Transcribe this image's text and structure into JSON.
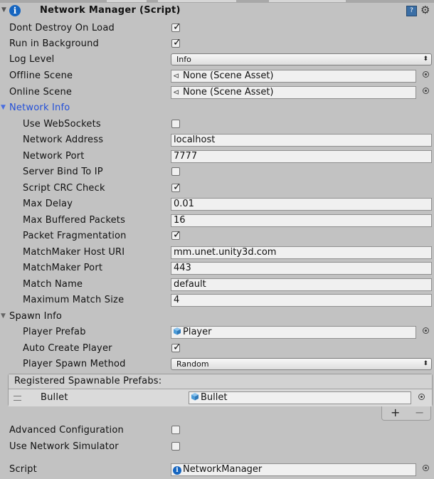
{
  "header": {
    "title": "Network Manager (Script)",
    "info_icon": "i",
    "book_icon": "?",
    "gear_icon": "⚙"
  },
  "rows": {
    "dont_destroy": {
      "label": "Dont Destroy On Load",
      "checked": true
    },
    "run_in_background": {
      "label": "Run in Background",
      "checked": true
    },
    "log_level": {
      "label": "Log Level",
      "value": "Info"
    },
    "offline_scene": {
      "label": "Offline Scene",
      "value": "None (Scene Asset)"
    },
    "online_scene": {
      "label": "Online Scene",
      "value": "None (Scene Asset)"
    }
  },
  "network_info": {
    "label": "Network Info",
    "use_websockets": {
      "label": "Use WebSockets",
      "checked": false
    },
    "network_address": {
      "label": "Network Address",
      "value": "localhost"
    },
    "network_port": {
      "label": "Network Port",
      "value": "7777"
    },
    "server_bind": {
      "label": "Server Bind To IP",
      "checked": false
    },
    "script_crc": {
      "label": "Script CRC Check",
      "checked": true
    },
    "max_delay": {
      "label": "Max Delay",
      "value": "0.01"
    },
    "max_buffered": {
      "label": "Max Buffered Packets",
      "value": "16"
    },
    "packet_frag": {
      "label": "Packet Fragmentation",
      "checked": true
    },
    "mm_host": {
      "label": "MatchMaker Host URI",
      "value": "mm.unet.unity3d.com"
    },
    "mm_port": {
      "label": "MatchMaker Port",
      "value": "443"
    },
    "match_name": {
      "label": "Match Name",
      "value": "default"
    },
    "max_match_size": {
      "label": "Maximum Match Size",
      "value": "4"
    }
  },
  "spawn_info": {
    "label": "Spawn Info",
    "player_prefab": {
      "label": "Player Prefab",
      "value": "Player"
    },
    "auto_create": {
      "label": "Auto Create Player",
      "checked": true
    },
    "spawn_method": {
      "label": "Player Spawn Method",
      "value": "Random"
    },
    "registered": {
      "header": "Registered Spawnable Prefabs:",
      "items": [
        {
          "label": "Bullet",
          "value": "Bullet"
        }
      ],
      "add": "+",
      "remove": "−"
    }
  },
  "advanced": {
    "label": "Advanced Configuration",
    "checked": false
  },
  "simulator": {
    "label": "Use Network Simulator",
    "checked": false
  },
  "script": {
    "label": "Script",
    "value": "NetworkManager"
  },
  "glyphs": {
    "check": "✓",
    "fold_open": "▼",
    "arrows": "⬍",
    "scene_icon": "⊲",
    "cube": "cube-icon"
  },
  "colors": {
    "section_active": "#2450d8",
    "info_icon": "#1565c0",
    "cube": "#4b9bd8"
  }
}
